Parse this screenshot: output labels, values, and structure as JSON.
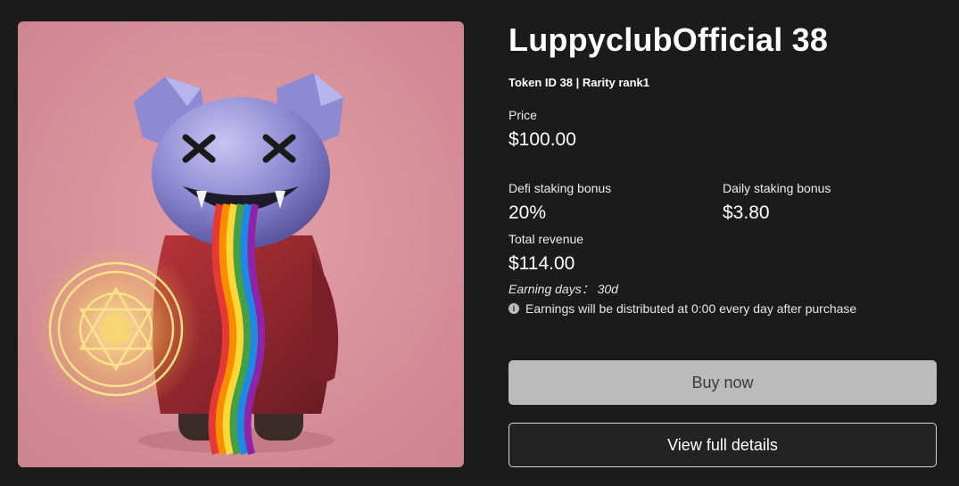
{
  "product": {
    "title": "LuppyclubOfficial 38",
    "token_label": "Token ID 38 | Rarity rank1",
    "image_alt": "Luppyclub NFT bear character with rainbow and magic circle"
  },
  "pricing": {
    "price_label": "Price",
    "price_value": "$100.00",
    "defi_label": "Defi staking bonus",
    "defi_value": "20%",
    "daily_label": "Daily staking bonus",
    "daily_value": "$3.80",
    "total_label": "Total revenue",
    "total_value": "$114.00",
    "earning_days": "Earning days： 30d",
    "note": "Earnings will be distributed at 0:00 every day after purchase"
  },
  "actions": {
    "buy_label": "Buy now",
    "view_label": "View full details"
  },
  "colors": {
    "background": "#1b1b1b",
    "artwork_bg": "#d98f99",
    "buy_button": "#bbbbbb",
    "view_button_border": "#d8d8d8"
  }
}
